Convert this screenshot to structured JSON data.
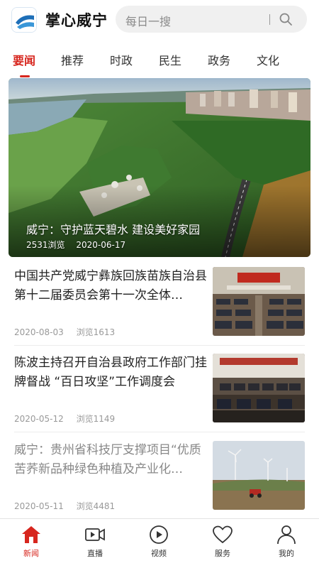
{
  "header": {
    "app_title": "掌心威宁",
    "search_placeholder": "每日一搜"
  },
  "tabs": [
    {
      "label": "要闻",
      "active": true
    },
    {
      "label": "推荐",
      "active": false
    },
    {
      "label": "时政",
      "active": false
    },
    {
      "label": "民生",
      "active": false
    },
    {
      "label": "政务",
      "active": false
    },
    {
      "label": "文化",
      "active": false
    }
  ],
  "hero": {
    "title": "威宁：守护蓝天碧水 建设美好家园",
    "views": "2531浏览",
    "date": "2020-06-17"
  },
  "news": [
    {
      "title": "中国共产党威宁彝族回族苗族自治县第十二届委员会第十一次全体…",
      "date": "2020-08-03",
      "views": "浏览1613"
    },
    {
      "title": "陈波主持召开自治县政府工作部门挂牌督战 “百日攻坚”工作调度会",
      "date": "2020-05-12",
      "views": "浏览1149"
    },
    {
      "title": "威宁：贵州省科技厅支撑项目“优质苦荞新品种绿色种植及产业化…",
      "date": "2020-05-11",
      "views": "浏览4481"
    }
  ],
  "bottom_nav": [
    {
      "label": "新闻",
      "icon": "home-icon",
      "active": true
    },
    {
      "label": "直播",
      "icon": "video-camera-icon",
      "active": false
    },
    {
      "label": "视频",
      "icon": "play-circle-icon",
      "active": false
    },
    {
      "label": "服务",
      "icon": "heart-icon",
      "active": false
    },
    {
      "label": "我的",
      "icon": "person-icon",
      "active": false
    }
  ],
  "colors": {
    "accent": "#d7261e",
    "text": "#222222",
    "muted": "#999999"
  }
}
